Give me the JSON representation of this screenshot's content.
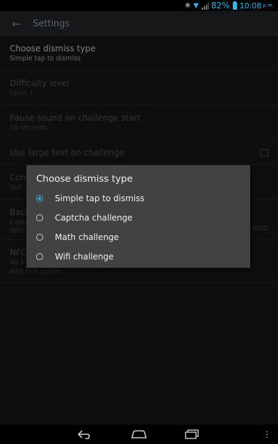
{
  "status_bar": {
    "battery_percent": "82%",
    "time": "10:08",
    "ampm": "p.m.",
    "icons": [
      "bluetooth-icon",
      "wifi-icon",
      "signal-icon",
      "battery-icon"
    ],
    "accent_color": "#33b5e5"
  },
  "action_bar": {
    "back_icon": "arrow-left-icon",
    "title": "Settings"
  },
  "settings": [
    {
      "title": "Choose dismiss type",
      "summary": "Simple tap to dismiss"
    },
    {
      "title": "Difficulty level",
      "summary": "Level 1"
    },
    {
      "title": "Pause sound on challenge start",
      "summary": "10 seconds"
    },
    {
      "title": "Use large text on challenge",
      "summary": ""
    },
    {
      "title": "Con",
      "summary": "Not c"
    },
    {
      "title": "Back",
      "summary": "Captc",
      "summary_tail": "SSID",
      "summary2": "INF0"
    },
    {
      "title": "NFC",
      "summary": "No b",
      "summary2": "with this option"
    }
  ],
  "dialog": {
    "title": "Choose dismiss type",
    "options": [
      {
        "label": "Simple tap to dismiss",
        "selected": true
      },
      {
        "label": "Captcha challenge",
        "selected": false
      },
      {
        "label": "Math challenge",
        "selected": false
      },
      {
        "label": "Wifi challenge",
        "selected": false
      }
    ]
  },
  "nav_bar": {
    "buttons": [
      "back-icon",
      "home-icon",
      "recent-apps-icon",
      "menu-icon"
    ]
  }
}
